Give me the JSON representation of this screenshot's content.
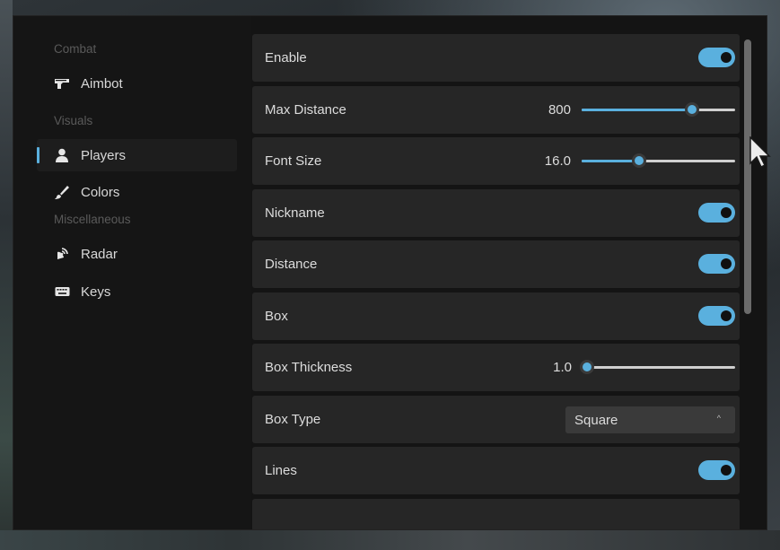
{
  "sidebar": {
    "sections": [
      {
        "title": "Combat"
      },
      {
        "title": "Visuals"
      },
      {
        "title": "Miscellaneous"
      }
    ],
    "items": [
      {
        "label": "Aimbot",
        "icon": "gun-icon"
      },
      {
        "label": "Players",
        "icon": "user-icon",
        "active": true
      },
      {
        "label": "Colors",
        "icon": "brush-icon"
      },
      {
        "label": "Radar",
        "icon": "radar-icon"
      },
      {
        "label": "Keys",
        "icon": "keyboard-icon"
      }
    ]
  },
  "settings": {
    "enable": {
      "label": "Enable",
      "on": true
    },
    "max_distance": {
      "label": "Max Distance",
      "value": "800",
      "level": 0.73
    },
    "font_size": {
      "label": "Font Size",
      "value": "16.0",
      "level": 0.37
    },
    "nickname": {
      "label": "Nickname",
      "on": true
    },
    "distance": {
      "label": "Distance",
      "on": true
    },
    "box": {
      "label": "Box",
      "on": true
    },
    "box_thickness": {
      "label": "Box Thickness",
      "value": "1.0",
      "level": 0.0
    },
    "box_type": {
      "label": "Box Type",
      "value": "Square",
      "arrow": "^"
    },
    "lines": {
      "label": "Lines",
      "on": true
    }
  },
  "colors": {
    "accent": "#5ab0de",
    "row_bg": "#262626",
    "window_bg": "#141414"
  }
}
